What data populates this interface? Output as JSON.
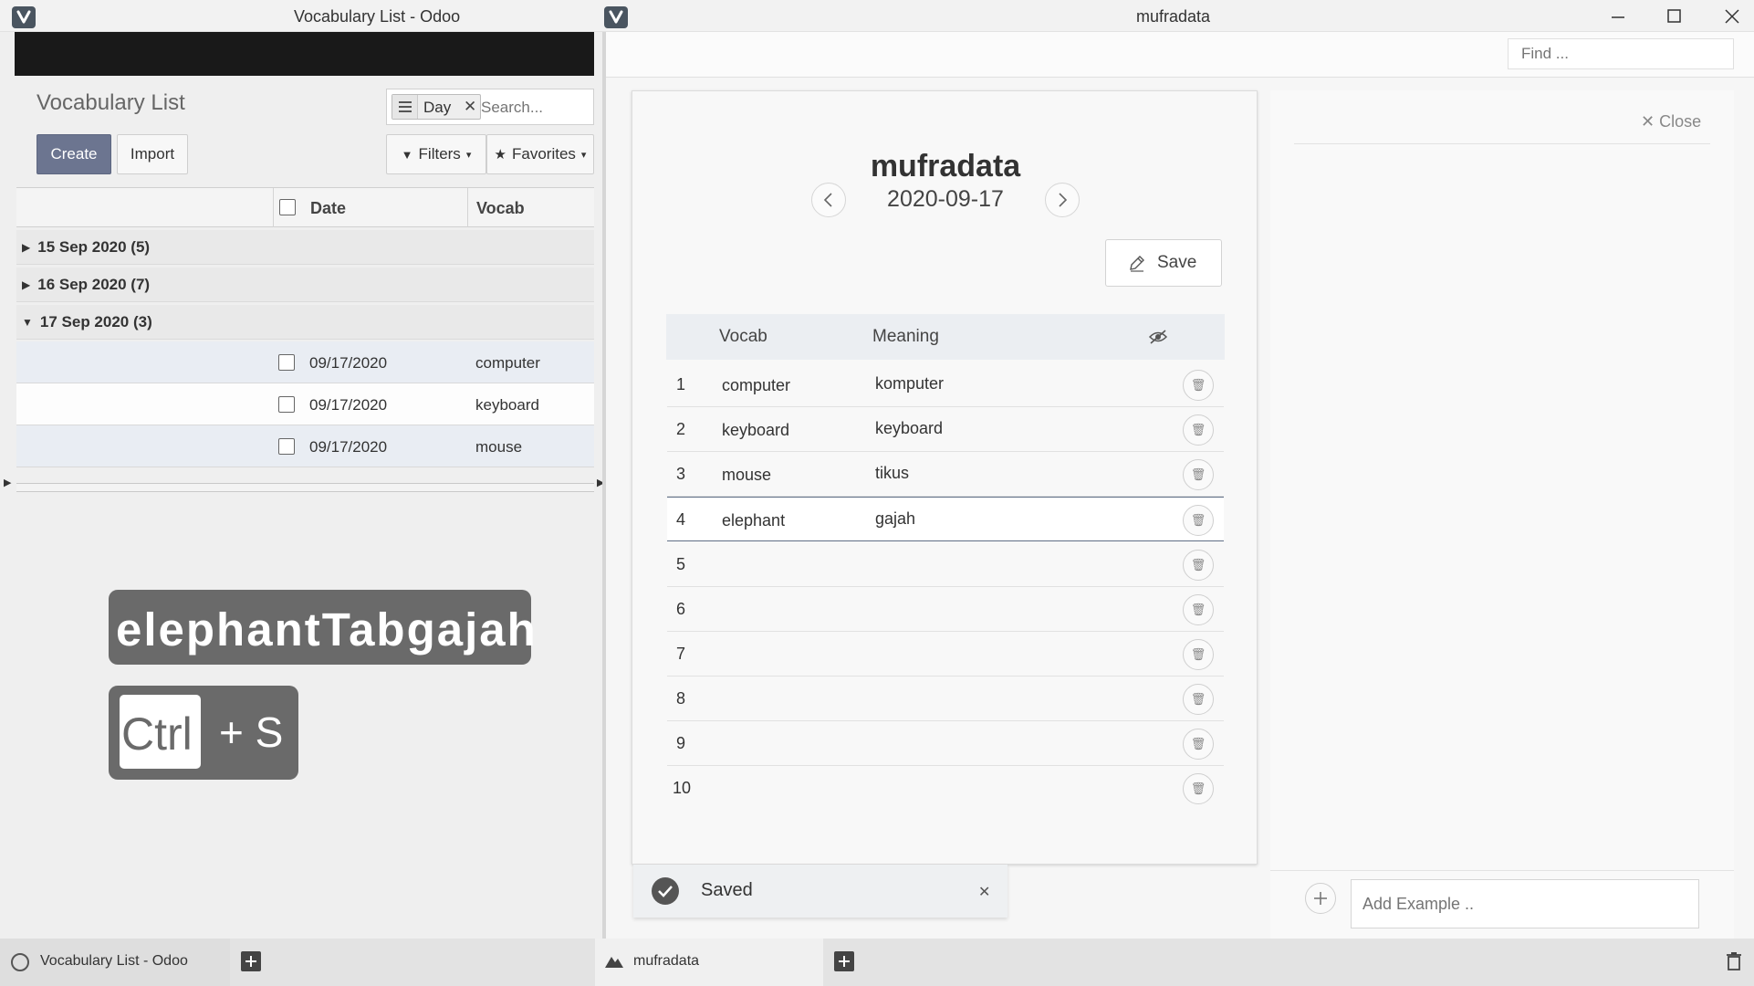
{
  "left_window": {
    "title": "Vocabulary List - Odoo",
    "page_title": "Vocabulary List",
    "create_label": "Create",
    "import_label": "Import",
    "search": {
      "facet_label": "Day",
      "placeholder": "Search..."
    },
    "filters_label": "Filters",
    "favorites_label": "Favorites",
    "columns": {
      "date": "Date",
      "vocab": "Vocab"
    },
    "groups": [
      {
        "label": "15 Sep 2020 (5)"
      },
      {
        "label": "16 Sep 2020 (7)"
      },
      {
        "label": "17 Sep 2020 (3)"
      }
    ],
    "records": [
      {
        "date": "09/17/2020",
        "vocab": "computer"
      },
      {
        "date": "09/17/2020",
        "vocab": "keyboard"
      },
      {
        "date": "09/17/2020",
        "vocab": "mouse"
      }
    ],
    "keystroke_text": "elephantTabgajah",
    "shortcut": {
      "key1": "Ctrl",
      "rest": "+ S"
    }
  },
  "right_window": {
    "title": "mufradata",
    "find_placeholder": "Find ...",
    "card_title": "mufradata",
    "card_date": "2020-09-17",
    "save_label": "Save",
    "columns": {
      "vocab": "Vocab",
      "meaning": "Meaning"
    },
    "rows": [
      {
        "num": "1",
        "vocab": "computer",
        "meaning": "komputer"
      },
      {
        "num": "2",
        "vocab": "keyboard",
        "meaning": "keyboard"
      },
      {
        "num": "3",
        "vocab": "mouse",
        "meaning": "tikus"
      },
      {
        "num": "4",
        "vocab": "elephant",
        "meaning": "gajah"
      },
      {
        "num": "5",
        "vocab": "",
        "meaning": ""
      },
      {
        "num": "6",
        "vocab": "",
        "meaning": ""
      },
      {
        "num": "7",
        "vocab": "",
        "meaning": ""
      },
      {
        "num": "8",
        "vocab": "",
        "meaning": ""
      },
      {
        "num": "9",
        "vocab": "",
        "meaning": ""
      },
      {
        "num": "10",
        "vocab": "",
        "meaning": ""
      }
    ],
    "toast_label": "Saved",
    "close_label": "Close",
    "add_example_placeholder": "Add Example .."
  },
  "tabbar": {
    "tab1_label": "Vocabulary List - Odoo",
    "tab2_label": "mufradata"
  }
}
